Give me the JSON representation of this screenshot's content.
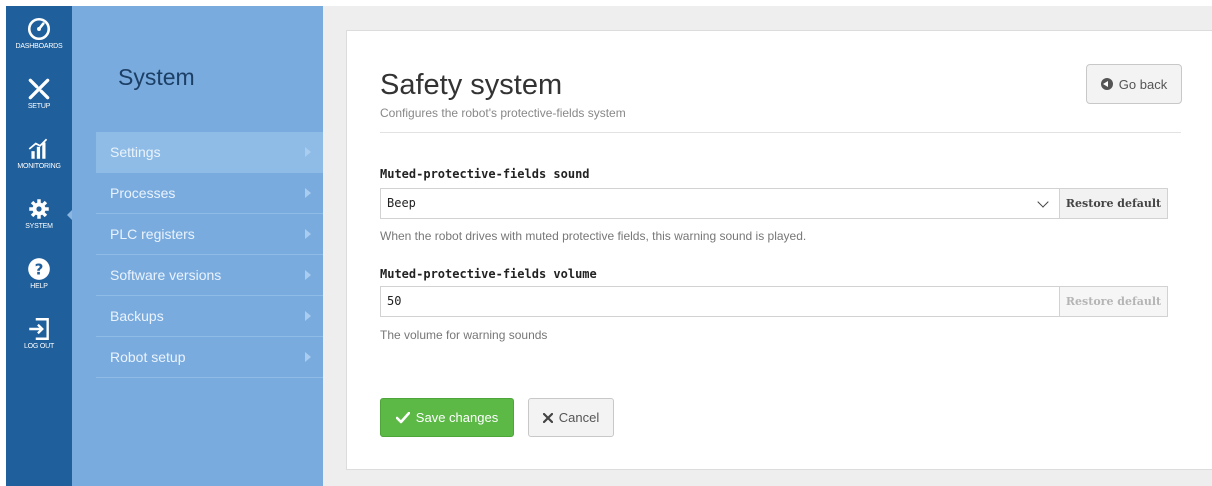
{
  "rail": {
    "items": [
      {
        "label": "DASHBOARDS",
        "icon": "dashboard-icon"
      },
      {
        "label": "SETUP",
        "icon": "setup-tools-icon"
      },
      {
        "label": "MONITORING",
        "icon": "monitoring-icon"
      },
      {
        "label": "SYSTEM",
        "icon": "gear-icon"
      },
      {
        "label": "HELP",
        "icon": "help-icon"
      },
      {
        "label": "LOG OUT",
        "icon": "logout-icon"
      }
    ]
  },
  "subnav": {
    "title": "System",
    "items": [
      {
        "label": "Settings"
      },
      {
        "label": "Processes"
      },
      {
        "label": "PLC registers"
      },
      {
        "label": "Software versions"
      },
      {
        "label": "Backups"
      },
      {
        "label": "Robot setup"
      }
    ]
  },
  "page": {
    "title": "Safety system",
    "subtitle": "Configures the robot's protective-fields system",
    "go_back": "Go back"
  },
  "fields": {
    "sound": {
      "label": "Muted-protective-fields sound",
      "value": "Beep",
      "restore": "Restore default",
      "help": "When the robot drives with muted protective fields, this warning sound is played."
    },
    "volume": {
      "label": "Muted-protective-fields volume",
      "value": "50",
      "restore": "Restore default",
      "help": "The volume for warning sounds"
    }
  },
  "actions": {
    "save": "Save changes",
    "cancel": "Cancel"
  },
  "colors": {
    "rail": "#1f5f9c",
    "subnav": "#7aabde",
    "save": "#5cb946"
  }
}
